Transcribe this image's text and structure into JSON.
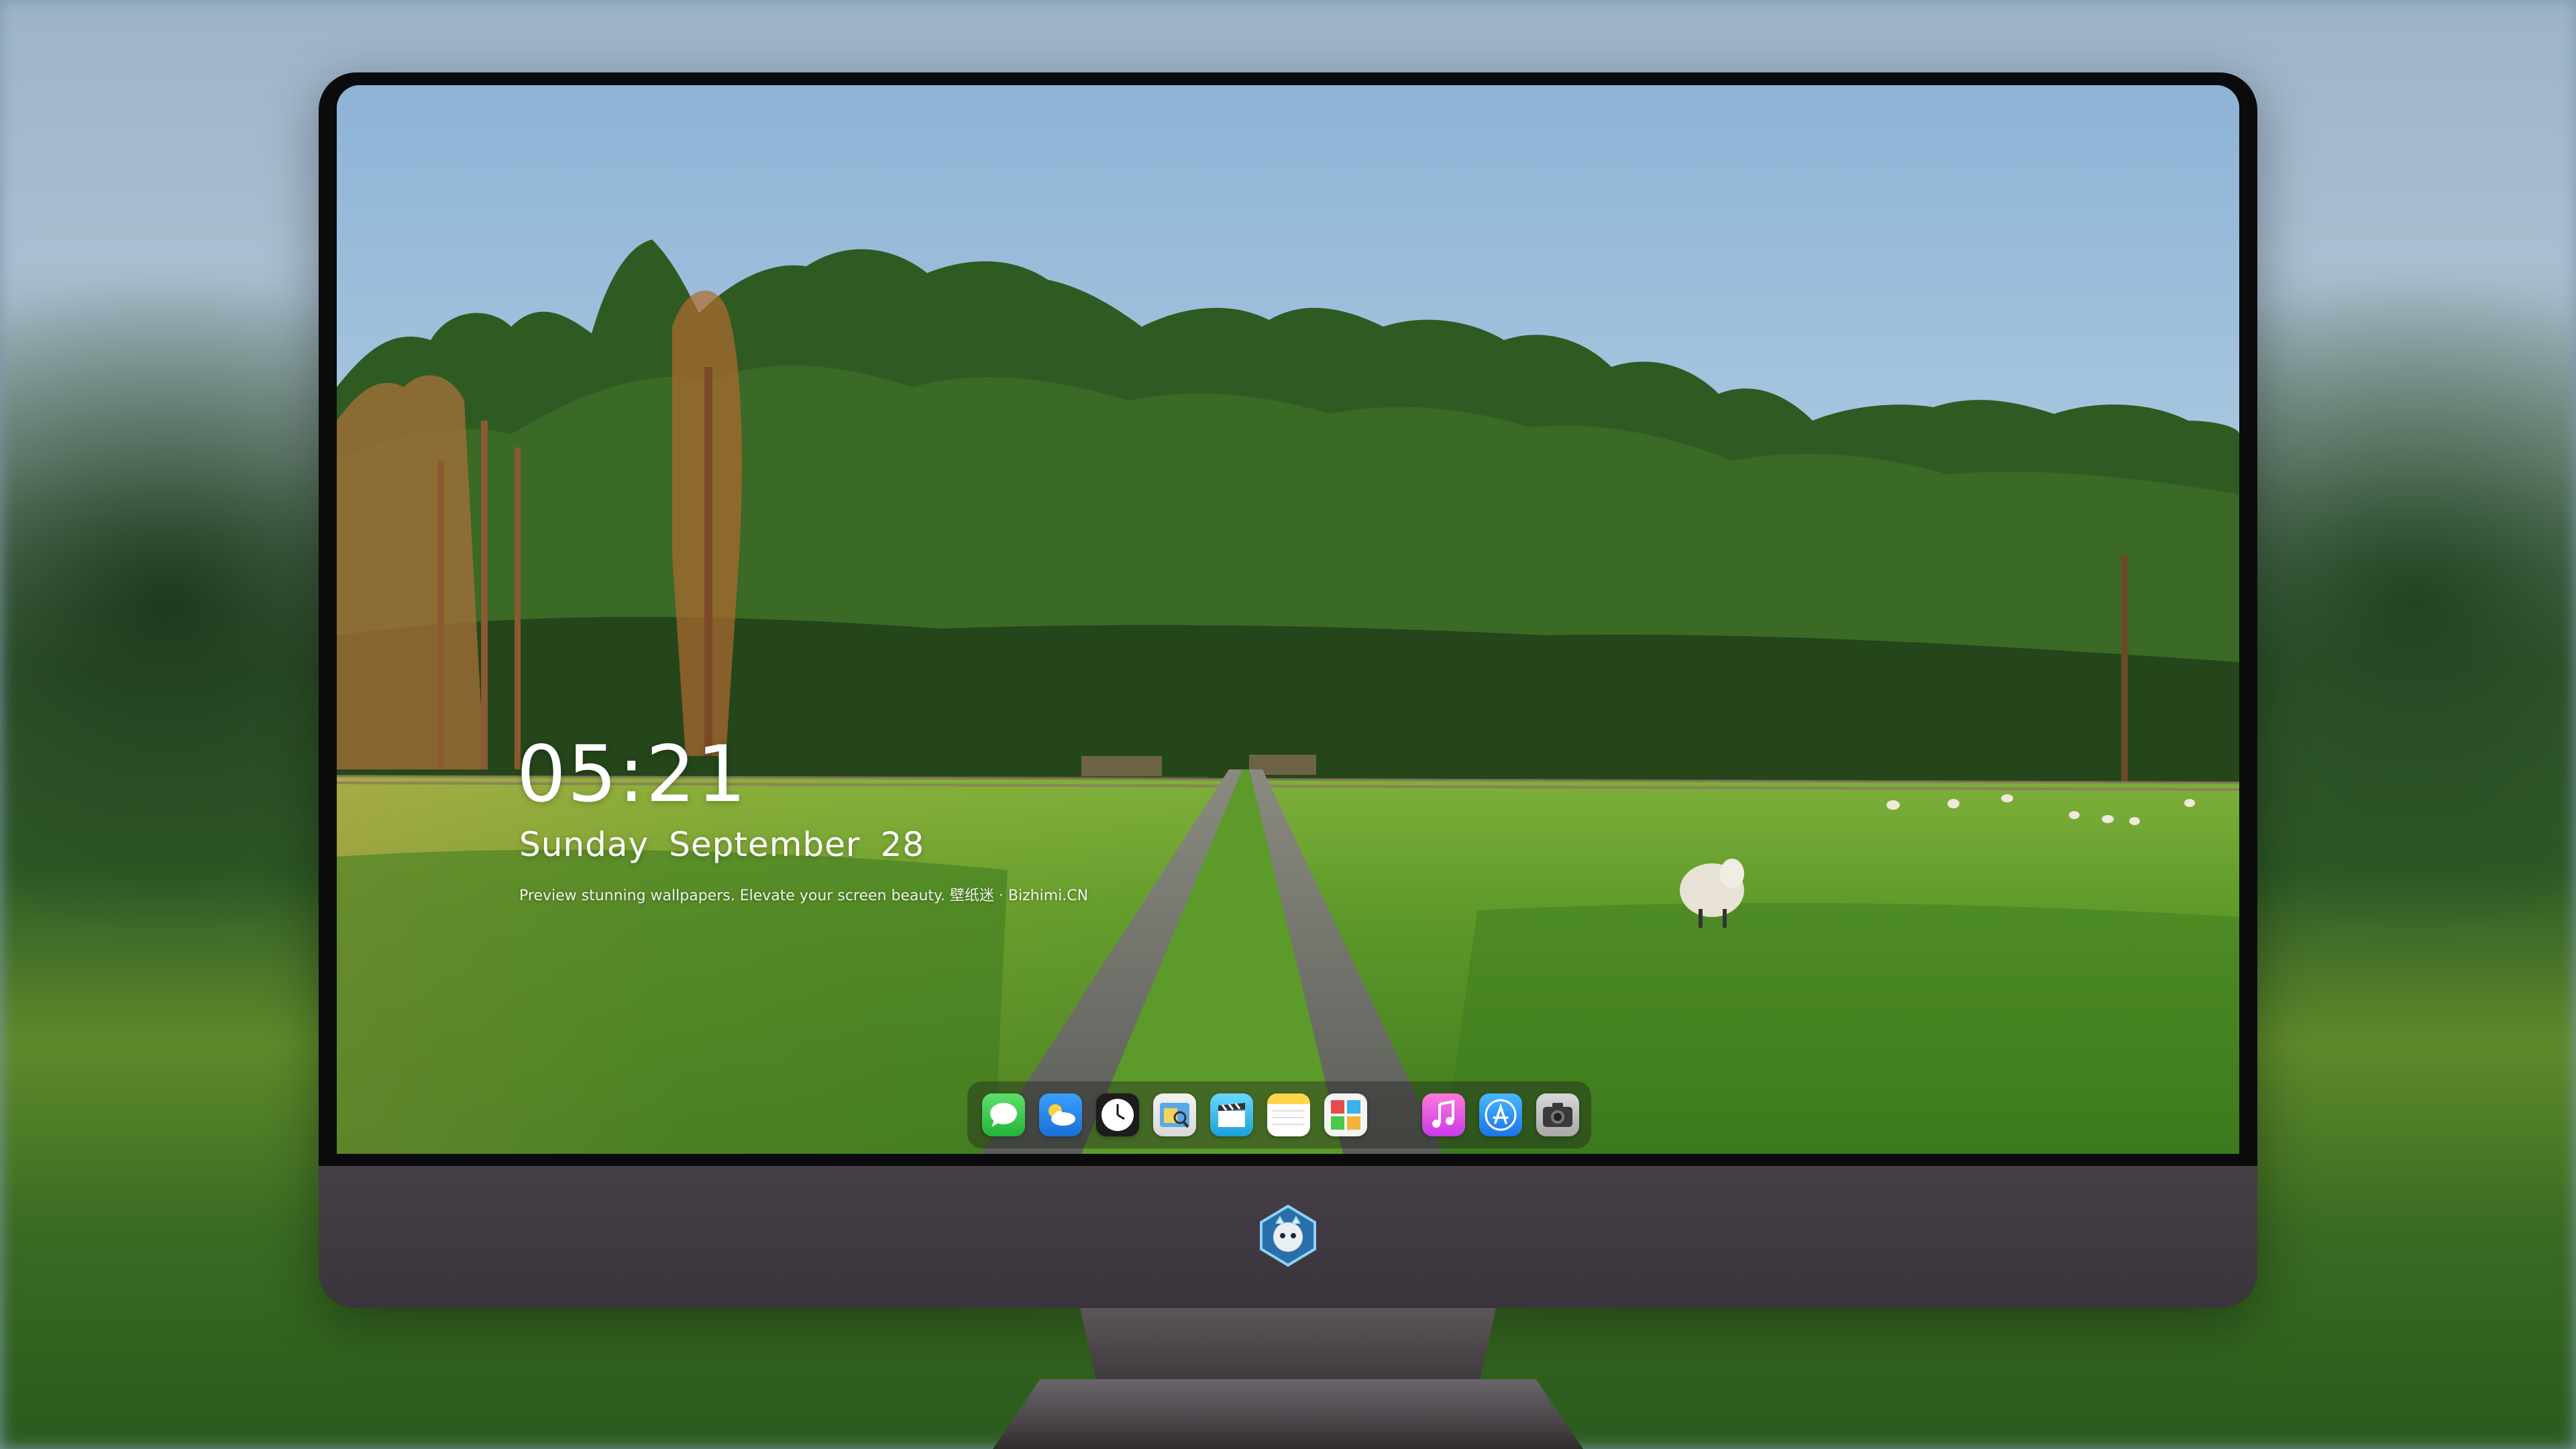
{
  "lockscreen": {
    "time": "05:21",
    "date_day": "Sunday",
    "date_month": "September",
    "date_num": "28",
    "tagline": "Preview stunning wallpapers. Elevate your screen beauty. 壁纸迷 · Bizhimi.CN"
  },
  "dock": {
    "apps": [
      {
        "name": "messages",
        "icon": "messages-icon"
      },
      {
        "name": "weather",
        "icon": "weather-icon"
      },
      {
        "name": "clock",
        "icon": "clock-icon"
      },
      {
        "name": "preview",
        "icon": "preview-icon"
      },
      {
        "name": "video",
        "icon": "clapper-icon"
      },
      {
        "name": "notes",
        "icon": "notes-icon"
      },
      {
        "name": "photo-booth",
        "icon": "photo-booth-icon"
      },
      {
        "name": "music",
        "icon": "music-icon"
      },
      {
        "name": "app-store",
        "icon": "app-store-icon"
      },
      {
        "name": "camera",
        "icon": "camera-icon"
      }
    ]
  },
  "colors": {
    "dock_bg": "#191919",
    "chin": "#3f3a40",
    "bezel": "#0b0b0d"
  }
}
